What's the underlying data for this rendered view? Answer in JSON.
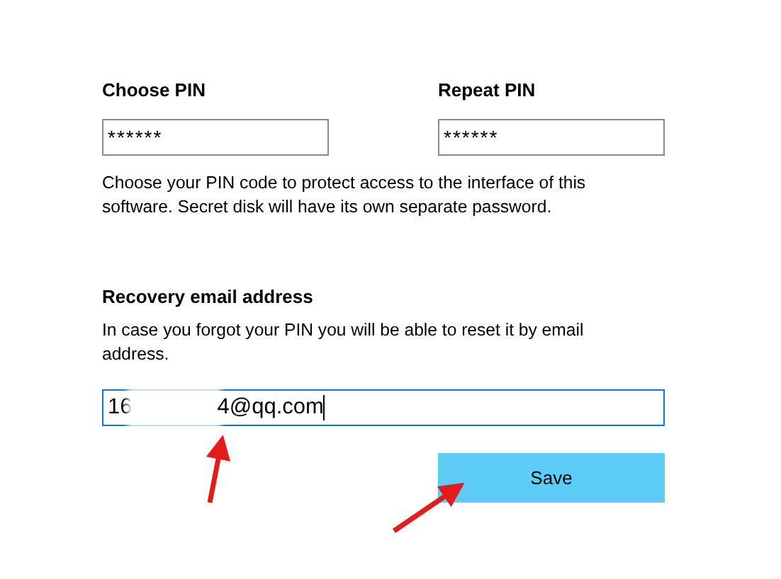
{
  "pin_fields": [
    {
      "label": "Choose PIN",
      "value": "******"
    },
    {
      "label": "Repeat PIN",
      "value": "******"
    }
  ],
  "pin_hint": "Choose your PIN code to protect access to the interface of this software. Secret disk will have its own separate password.",
  "recovery": {
    "label": "Recovery email address",
    "hint": "In case you forgot your PIN you will be able to reset it by email address.",
    "value_parts": [
      "16",
      "4@qq.com"
    ],
    "focused": true
  },
  "buttons": [
    {
      "label": "Save"
    }
  ]
}
